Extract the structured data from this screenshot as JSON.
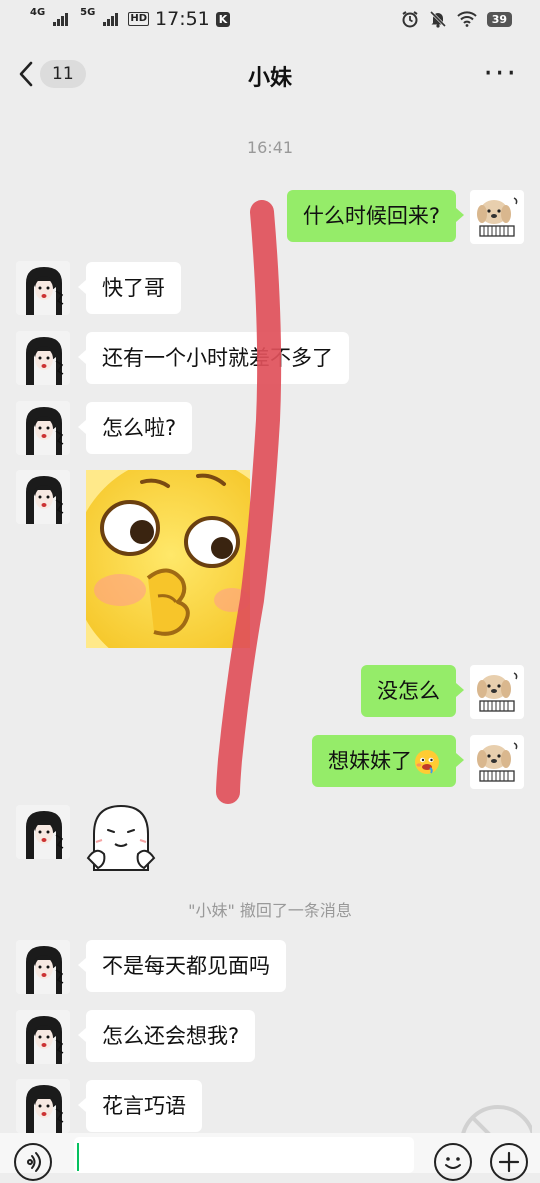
{
  "status_bar": {
    "net1": "4G",
    "net2": "5G",
    "hd": "HD",
    "time": "17:51",
    "app_badge": "K",
    "battery": "39",
    "icons": [
      "alarm-icon",
      "mute-icon",
      "wifi-icon",
      "battery-icon"
    ]
  },
  "nav": {
    "unread_count": "11",
    "title": "小妹",
    "more_label": "···",
    "icons": [
      "back-chevron-icon",
      "more-icon"
    ]
  },
  "chat": {
    "timestamp": "16:41",
    "messages": [
      {
        "side": "right",
        "type": "text",
        "text": "什么时候回来?"
      },
      {
        "side": "left",
        "type": "text",
        "text": "快了哥"
      },
      {
        "side": "left",
        "type": "text",
        "text": "还有一个小时就差不多了"
      },
      {
        "side": "left",
        "type": "text",
        "text": "怎么啦?"
      },
      {
        "side": "left",
        "type": "sticker",
        "sticker": "yellow-face-sticker"
      },
      {
        "side": "right",
        "type": "text",
        "text": "没怎么"
      },
      {
        "side": "right",
        "type": "text",
        "text": "想妹妹了",
        "emoji": "drooling-face-emoji"
      },
      {
        "side": "left",
        "type": "sticker",
        "sticker": "shy-blob-sticker"
      },
      {
        "side": "left",
        "type": "text",
        "text": "不是每天都见面吗"
      },
      {
        "side": "left",
        "type": "text",
        "text": "怎么还会想我?"
      },
      {
        "side": "left",
        "type": "text",
        "text": "花言巧语"
      }
    ],
    "recall_notice": "\"小妹\" 撤回了一条消息",
    "bubble_color_self": "#95ec69",
    "bubble_color_other": "#ffffff",
    "background": "#ededed"
  },
  "annotation": {
    "stroke_color": "#e0505a"
  },
  "input_bar": {
    "icons": [
      "voice-icon",
      "emoji-icon",
      "plus-icon"
    ],
    "cursor_color": "#07c160"
  }
}
